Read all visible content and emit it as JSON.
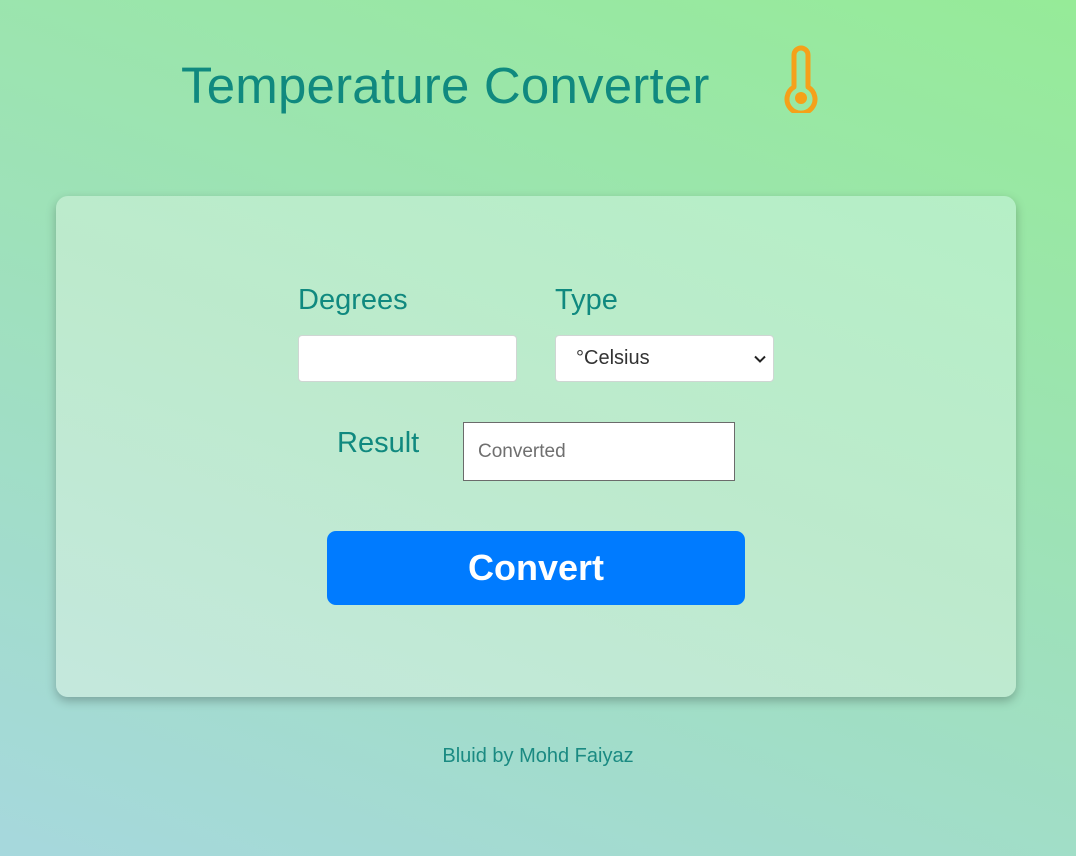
{
  "header": {
    "title": "Temperature Converter",
    "icon": "thermometer-icon",
    "icon_color": "#f5a11a"
  },
  "form": {
    "degrees_label": "Degrees",
    "degrees_value": "",
    "type_label": "Type",
    "type_selected": "°Celsius",
    "result_label": "Result",
    "result_placeholder": "Converted",
    "convert_label": "Convert"
  },
  "footer": {
    "credit": "Bluid by Mohd Faiyaz"
  },
  "colors": {
    "text_primary": "#10897f",
    "button_bg": "#007bff",
    "button_text": "#ffffff"
  }
}
